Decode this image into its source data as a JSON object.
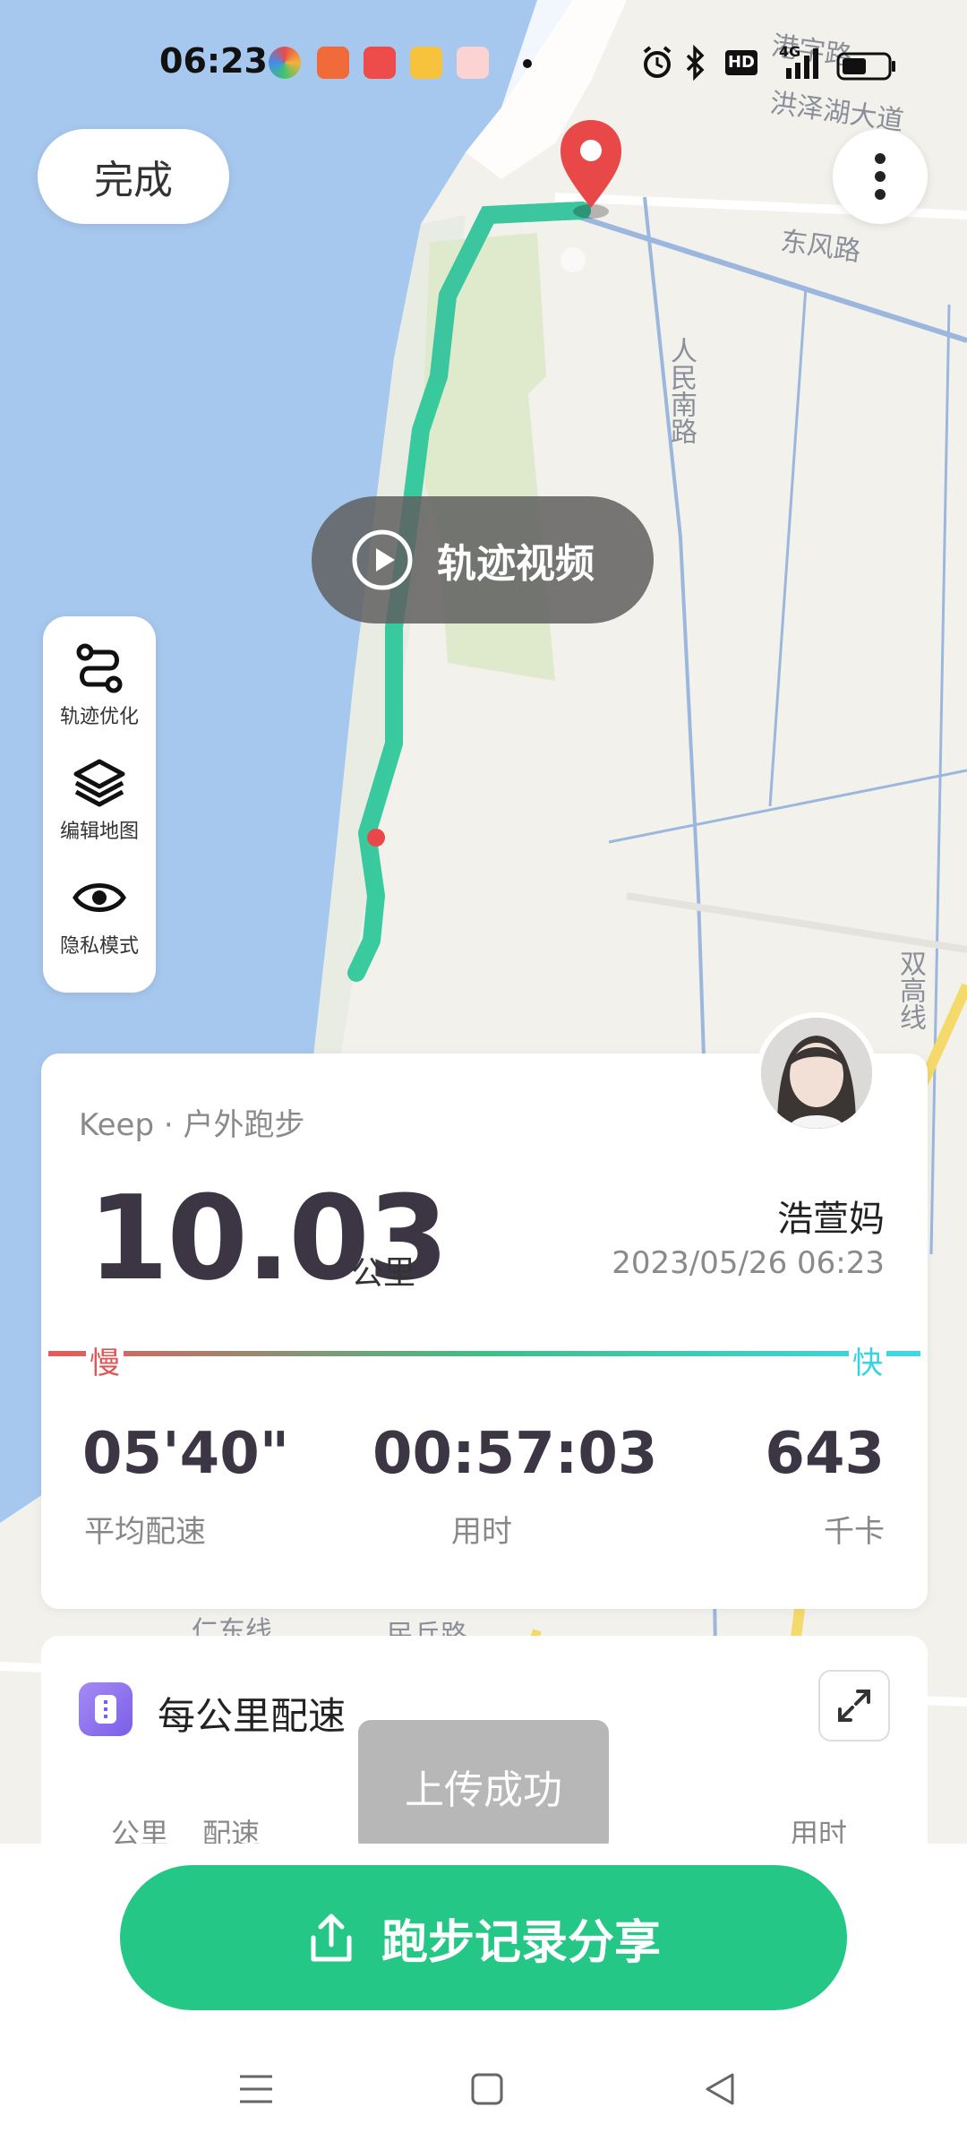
{
  "status_bar": {
    "time": "06:23",
    "network": "4G",
    "hd": "HD"
  },
  "map": {
    "labels": [
      "洪泽湖大道",
      "东风路",
      "人民南路",
      "双高线",
      "仁东线",
      "民兵路",
      "港字路"
    ]
  },
  "top": {
    "done_label": "完成",
    "more_icon": "more-vertical-icon"
  },
  "video": {
    "label": "轨迹视频"
  },
  "tools": [
    {
      "label": "轨迹优化",
      "icon": "route-optimize-icon"
    },
    {
      "label": "编辑地图",
      "icon": "layers-icon"
    },
    {
      "label": "隐私模式",
      "icon": "eye-icon"
    }
  ],
  "summary": {
    "source": "Keep · 户外跑步",
    "distance": "10.03",
    "unit": "公里",
    "user_name": "浩萱妈",
    "date": "2023/05/26 06:23",
    "slow_label": "慢",
    "fast_label": "快",
    "stats": [
      {
        "value": "05'40\"",
        "label": "平均配速"
      },
      {
        "value": "00:57:03",
        "label": "用时"
      },
      {
        "value": "643",
        "label": "千卡"
      }
    ]
  },
  "pace_card": {
    "title": "每公里配速",
    "col_km": "公里",
    "col_pace": "配速",
    "col_time": "用时"
  },
  "toast": {
    "text": "上传成功"
  },
  "share": {
    "label": "跑步记录分享"
  },
  "colors": {
    "accent_green": "#25c787",
    "route_green": "#2ec79a",
    "marker_red": "#e84848"
  }
}
